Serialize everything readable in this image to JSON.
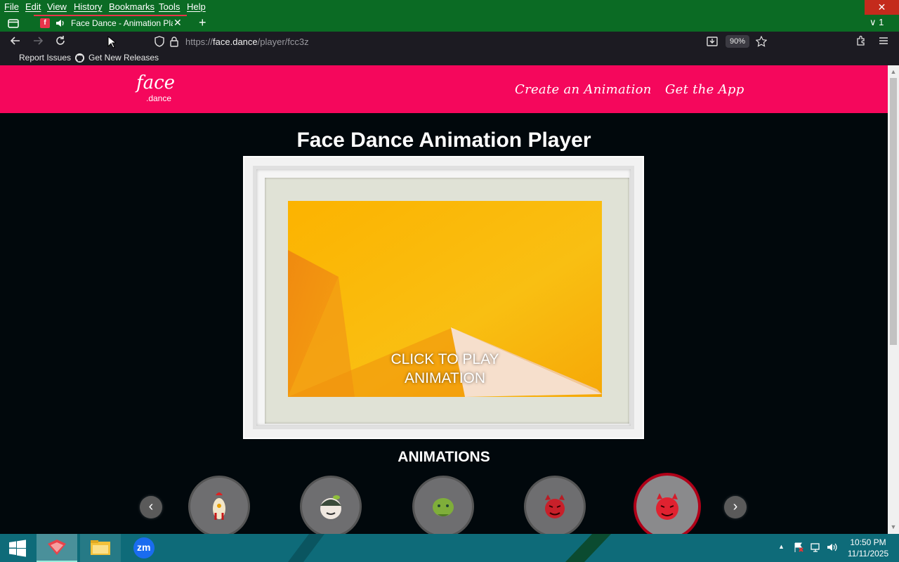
{
  "menubar": {
    "items": [
      "File",
      "Edit",
      "View",
      "History",
      "Bookmarks",
      "Tools",
      "Help"
    ]
  },
  "window_controls": {
    "close": "✕"
  },
  "tab": {
    "title": "Face Dance - Animation Pla",
    "favicon_letter": "f",
    "close": "✕"
  },
  "tabbar": {
    "new_tab": "+",
    "tab_count": "1"
  },
  "navbar": {
    "url_prefix": "https://",
    "url_host": "face.dance",
    "url_path": "/player/fcc3z",
    "zoom": "90%"
  },
  "bookmarks": {
    "items": [
      "Report Issues",
      "Get New Releases"
    ]
  },
  "site": {
    "logo_top": "face",
    "logo_bottom": ".dance",
    "nav": [
      "Create an Animation",
      "Get the App"
    ],
    "page_title": "Face Dance Animation Player",
    "player_label_line1": "CLICK TO PLAY",
    "player_label_line2": "ANIMATION",
    "animations_heading": "ANIMATIONS",
    "animations": [
      {
        "icon": "chicken-face-icon",
        "selected": false
      },
      {
        "icon": "elf-face-icon",
        "selected": false
      },
      {
        "icon": "goblin-face-icon",
        "selected": false
      },
      {
        "icon": "devil-face-icon",
        "selected": false
      },
      {
        "icon": "devil-face-icon",
        "selected": true
      }
    ]
  },
  "taskbar": {
    "apps": [
      "Firefox",
      "File Explorer",
      "Zoom"
    ],
    "zoom_label": "zm",
    "time": "10:50 PM",
    "date": "11/11/2025"
  },
  "colors": {
    "brand_pink": "#f5075c",
    "menubar_green": "#0b6b24",
    "page_bg": "#01080c",
    "taskbar_teal": "#0e6b79"
  }
}
